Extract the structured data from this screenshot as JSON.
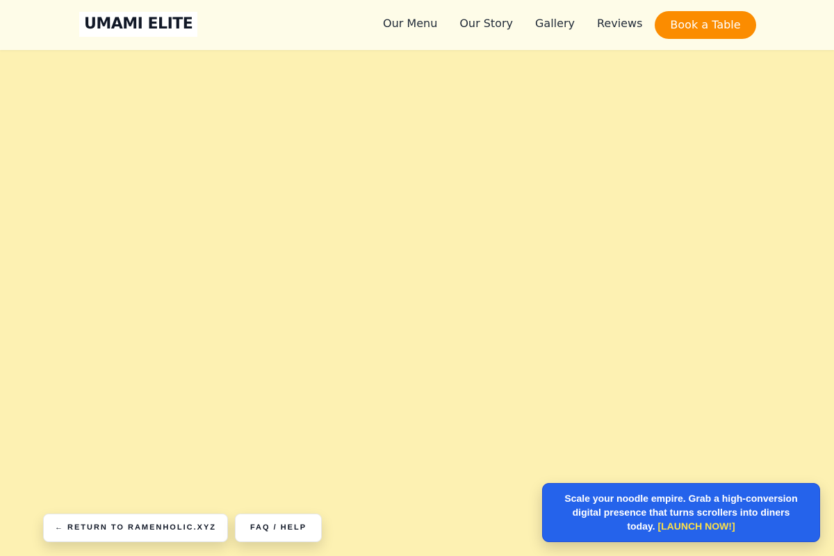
{
  "header": {
    "logo": "UMAMI ELITE",
    "nav": [
      "Our Menu",
      "Our Story",
      "Gallery",
      "Reviews"
    ],
    "cta": "Book a Table"
  },
  "footer_links": {
    "return": "← RETURN TO RAMENHOLIC.XYZ",
    "faq": "FAQ / HELP"
  },
  "promo": {
    "text": "Scale your noodle empire. Grab a high-conversion digital presence that turns scrollers into diners today.",
    "link": "[LAUNCH NOW!]"
  },
  "colors": {
    "background": "#fdf1b2",
    "header": "#fefce8",
    "accent": "#fb8c00",
    "promo": "#2563eb",
    "promo_link": "#fde047"
  }
}
